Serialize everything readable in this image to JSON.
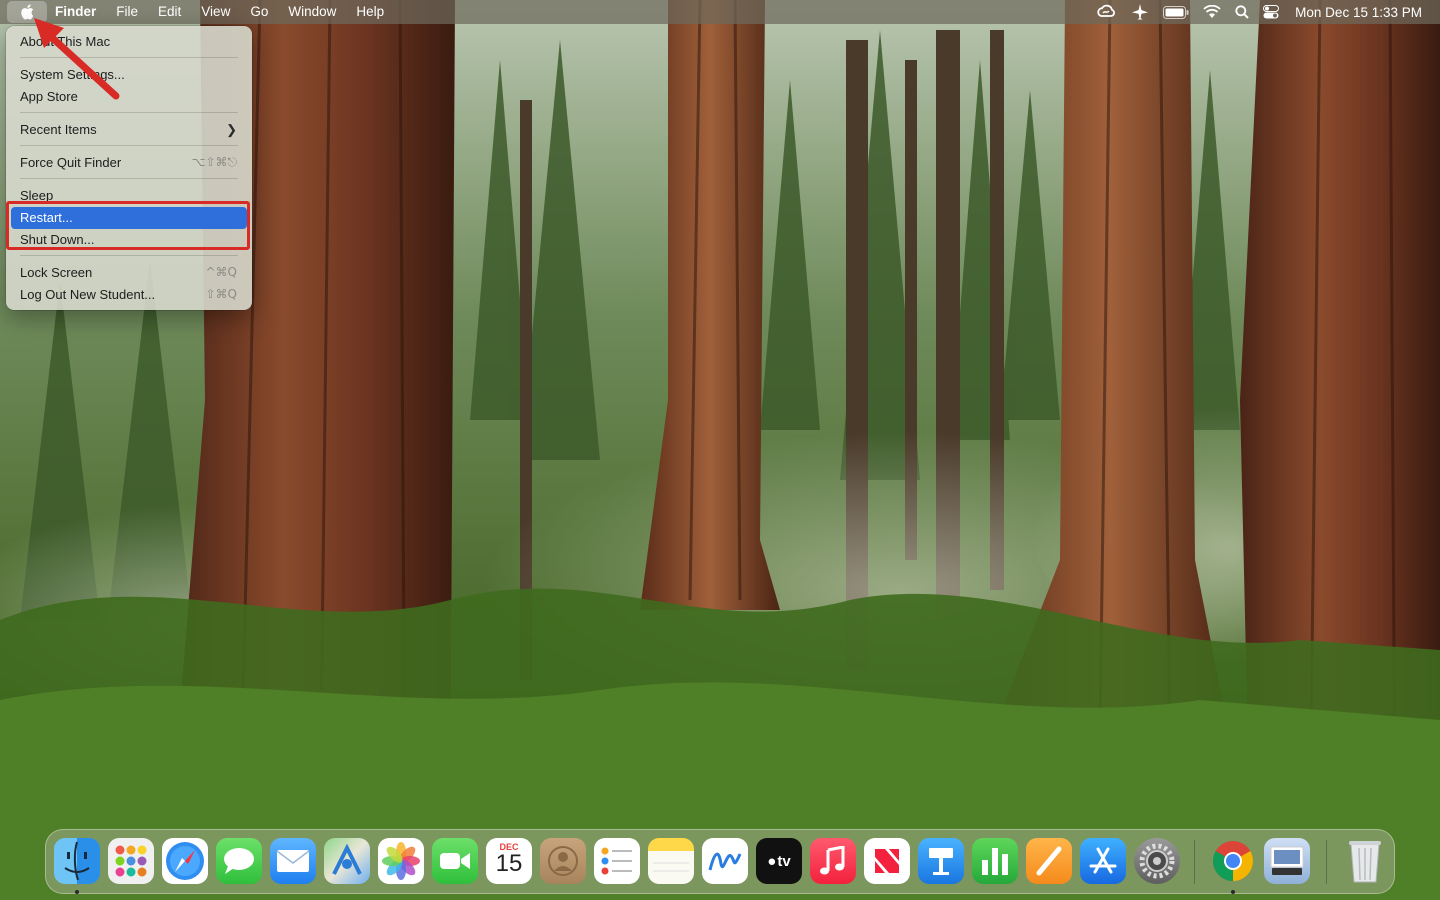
{
  "menubar": {
    "app_name": "Finder",
    "menus": [
      "File",
      "Edit",
      "View",
      "Window",
      "Help"
    ],
    "clock": "Mon Dec 15  1:33 PM"
  },
  "apple_menu": {
    "items": [
      {
        "label": "About This Mac",
        "shortcut": ""
      },
      {
        "label": "System Settings...",
        "shortcut": ""
      },
      {
        "label": "App Store",
        "shortcut": ""
      },
      {
        "label": "Recent Items",
        "shortcut": ""
      },
      {
        "label": "Force Quit Finder",
        "shortcut": "⌥⇧⌘⎋"
      },
      {
        "label": "Sleep",
        "shortcut": ""
      },
      {
        "label": "Restart...",
        "shortcut": ""
      },
      {
        "label": "Shut Down...",
        "shortcut": ""
      },
      {
        "label": "Lock Screen",
        "shortcut": "^⌘Q"
      },
      {
        "label": "Log Out New Student...",
        "shortcut": "⇧⌘Q"
      }
    ],
    "highlighted": "Restart..."
  },
  "dock": {
    "apps": [
      "Finder",
      "Launchpad",
      "Safari",
      "Messages",
      "Mail",
      "Maps",
      "Photos",
      "FaceTime",
      "Calendar",
      "Contacts",
      "Reminders",
      "Notes",
      "Freeform",
      "TV",
      "Music",
      "News",
      "Keynote",
      "Numbers",
      "Pages",
      "App Store",
      "System Settings",
      "Chrome",
      "Preview",
      "Trash"
    ],
    "calendar_month": "DEC",
    "calendar_day": "15",
    "tv_label": "tv"
  },
  "colors": {
    "menu_highlight": "#2f6fdc",
    "annotation": "#d92b25"
  }
}
